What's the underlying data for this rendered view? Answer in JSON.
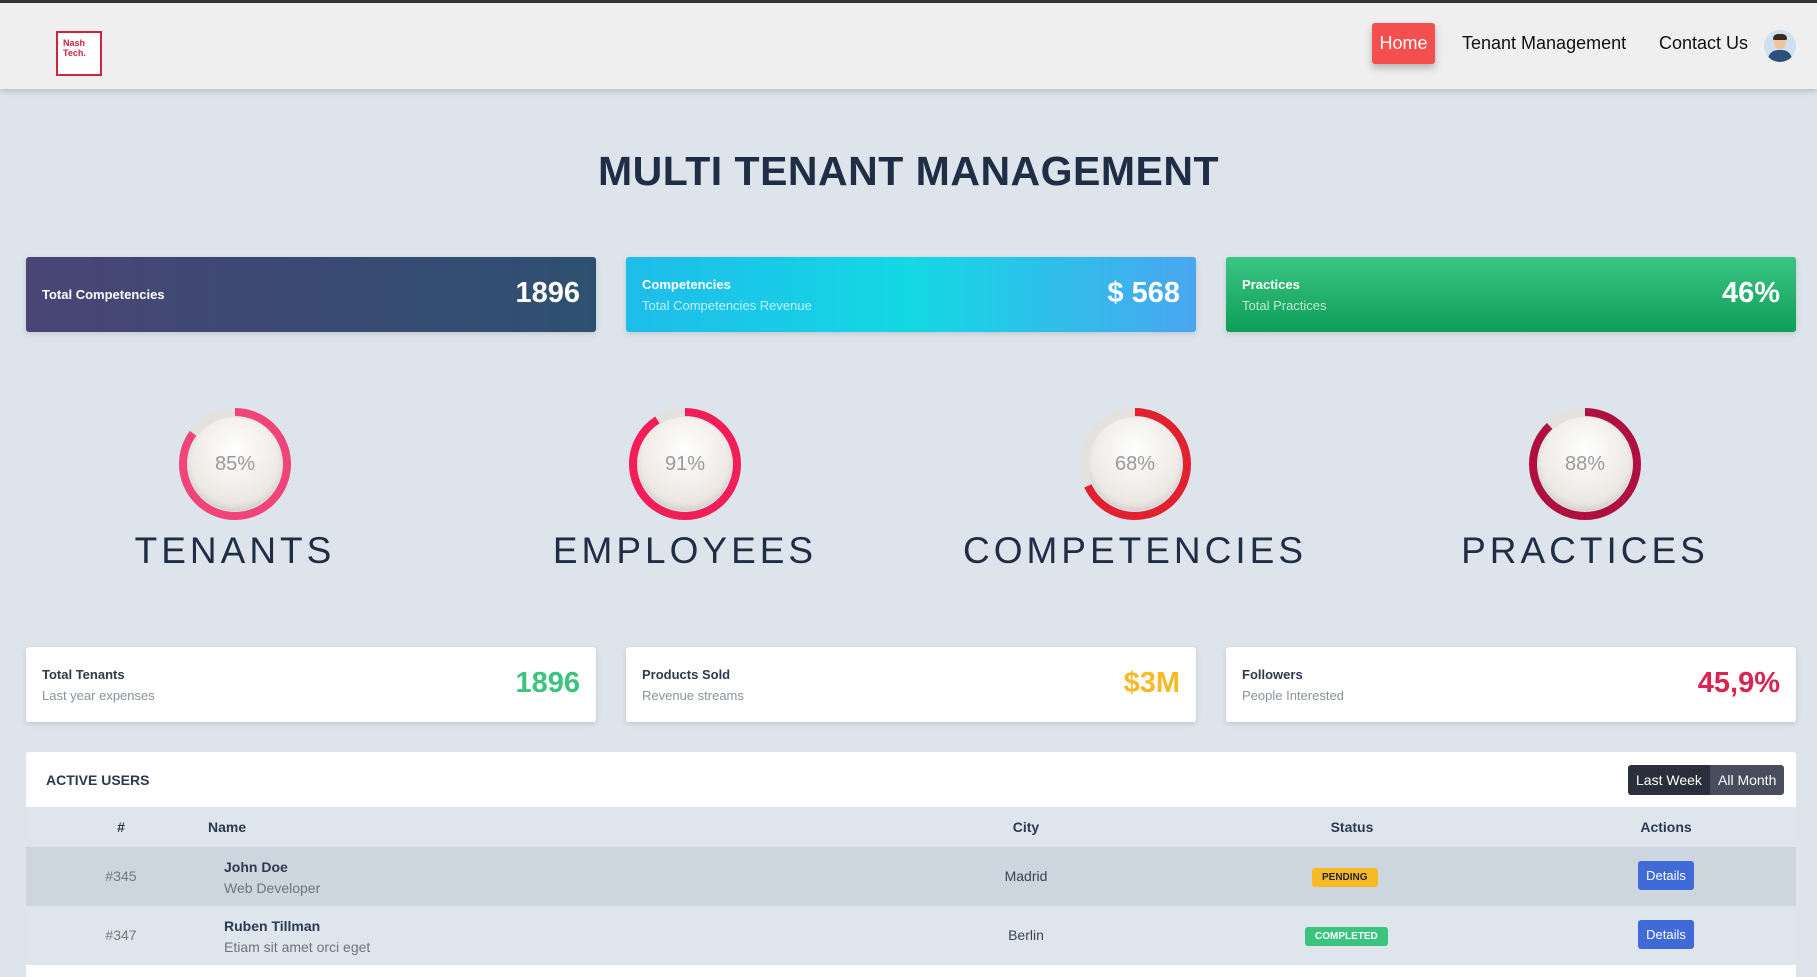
{
  "nav": {
    "logo_line1": "Nash",
    "logo_line2": "Tech.",
    "home": "Home",
    "tenant_management": "Tenant Management",
    "contact_us": "Contact Us"
  },
  "page_title": "MULTI TENANT MANAGEMENT",
  "gradient_cards": [
    {
      "title": "Total Competencies",
      "subtitle": "",
      "value": "1896"
    },
    {
      "title": "Competencies",
      "subtitle": "Total Competencies Revenue",
      "value": "$ 568"
    },
    {
      "title": "Practices",
      "subtitle": "Total Practices",
      "value": "46%"
    }
  ],
  "gauges": [
    {
      "value": "85%",
      "fraction": 0.85,
      "label": "TENANTS",
      "color": "#f0447a"
    },
    {
      "value": "91%",
      "fraction": 0.91,
      "label": "EMPLOYEES",
      "color": "#f21e57"
    },
    {
      "value": "68%",
      "fraction": 0.68,
      "label": "COMPETENCIES",
      "color": "#e3202e"
    },
    {
      "value": "88%",
      "fraction": 0.88,
      "label": "PRACTICES",
      "color": "#b0103f"
    }
  ],
  "white_cards": [
    {
      "title": "Total Tenants",
      "subtitle": "Last year expenses",
      "value": "1896",
      "color": "#3ac47d"
    },
    {
      "title": "Products Sold",
      "subtitle": "Revenue streams",
      "value": "$3M",
      "color": "#f7b924"
    },
    {
      "title": "Followers",
      "subtitle": "People Interested",
      "value": "45,9%",
      "color": "#d92550"
    }
  ],
  "active_users": {
    "title": "ACTIVE USERS",
    "filters": [
      "Last Week",
      "All Month"
    ],
    "columns": [
      "#",
      "Name",
      "City",
      "Status",
      "Actions"
    ],
    "rows": [
      {
        "id": "#345",
        "name": "John Doe",
        "role": "Web Developer",
        "city": "Madrid",
        "status": "PENDING",
        "action": "Details"
      },
      {
        "id": "#347",
        "name": "Ruben Tillman",
        "role": "Etiam sit amet orci eget",
        "city": "Berlin",
        "status": "COMPLETED",
        "action": "Details"
      }
    ]
  }
}
